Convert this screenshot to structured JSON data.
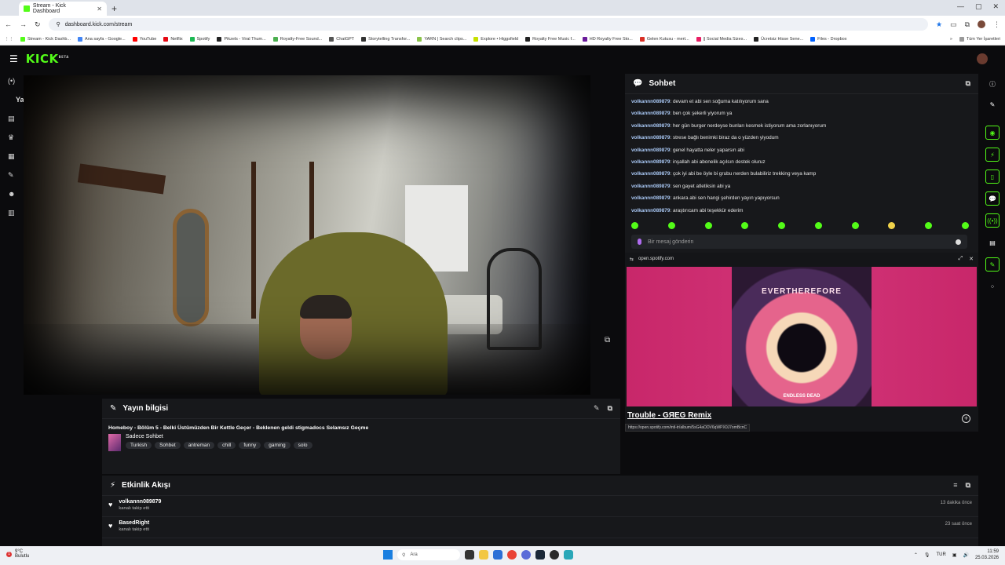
{
  "browser": {
    "tab_title": "Stream - Kick Dashboard",
    "new_tab": "+",
    "url": "dashboard.kick.com/stream",
    "bookmarks": [
      {
        "label": "Stream - Kick Dashb...",
        "color": "#53fc18"
      },
      {
        "label": "Ana sayfa - Google...",
        "color": "#4285f4"
      },
      {
        "label": "YouTube",
        "color": "#ff0000"
      },
      {
        "label": "Netflix",
        "color": "#e50914"
      },
      {
        "label": "Spotify",
        "color": "#1db954"
      },
      {
        "label": "Pikzels - Viral Thum...",
        "color": "#222222"
      },
      {
        "label": "Royalty-Free Sound...",
        "color": "#4caf50"
      },
      {
        "label": "ChatGPT",
        "color": "#555555"
      },
      {
        "label": "Storytelling Transfor...",
        "color": "#333333"
      },
      {
        "label": "YARN | Search clips...",
        "color": "#8bc34a"
      },
      {
        "label": "Explore • Higgsfield",
        "color": "#c6e000"
      },
      {
        "label": "Royalty Free Music f...",
        "color": "#222222"
      },
      {
        "label": "HD Royalty Free Sto...",
        "color": "#6a1b9a"
      },
      {
        "label": "Gelen Kutusu - mert...",
        "color": "#d93025"
      },
      {
        "label": "|| Social Media Sizes...",
        "color": "#e91e63"
      },
      {
        "label": "Ücretsiz Hisse Sene...",
        "color": "#222222"
      },
      {
        "label": "Files - Dropbox",
        "color": "#0061ff"
      }
    ],
    "bookmarks_more": "»",
    "all_bookmarks": "Tüm Yer İşaretleri"
  },
  "kick": {
    "logo": "KICK",
    "logo_badge": "BETA",
    "left_label": "Ya"
  },
  "chat": {
    "title": "Sohbet",
    "messages": [
      {
        "user": "volkannn089879",
        "text": "devam et abi sen soğuma katılıyorum sana"
      },
      {
        "user": "volkannn089879",
        "text": "ben çok şekerli yiyorum ya"
      },
      {
        "user": "volkannn089879",
        "text": "her gün burger nerdeyse bunları kesmek istiyorum ama zorlanıyorum"
      },
      {
        "user": "volkannn089879",
        "text": "strese bağlı benimki biraz da o yüzden yiyodum"
      },
      {
        "user": "volkannn089879",
        "text": "genel hayatta neler yaparsın abi"
      },
      {
        "user": "volkannn089879",
        "text": "inşallah abi abonelik açılsın destek oluruz"
      },
      {
        "user": "volkannn089879",
        "text": "çok iyi abi be öyle bi grubu nerden bulabiliriz trekking veya kamp"
      },
      {
        "user": "volkannn089879",
        "text": "sen gayet atletiksin abi ya"
      },
      {
        "user": "volkannn089879",
        "text": "ankara abi sen hangi şehirden yayın yapıyorsun"
      },
      {
        "user": "volkannn089879",
        "text": "araştırıcam abi teşekkür ederim"
      }
    ],
    "input_placeholder": "Bir mesaj gönderin"
  },
  "spotify": {
    "domain": "open.spotify.com",
    "art_title": "EVERTHEREFORE",
    "art_subtitle": "ENDLESS DEAD",
    "track": "Trouble - GЯEG Remix",
    "link": "https://open.spotify.com/intl-tr/album/5sG4aODV6qWPX0J7omBcnC"
  },
  "stream_info": {
    "heading": "Yayın bilgisi",
    "title": "Homeboy - Bölüm 5 - Belki Üstümüzden Bir Kettle Geçer - Beklenen geldi stigmadocs Selamsız Geçme",
    "category": "Sadece Sohbet",
    "tags": [
      "Turkish",
      "Sohbet",
      "antreman",
      "chill",
      "funny",
      "gaming",
      "solo"
    ]
  },
  "activity": {
    "heading": "Etkinlik Akışı",
    "items": [
      {
        "user": "volkannn089879",
        "action": "kanalı takip etti",
        "time": "13 dakika önce"
      },
      {
        "user": "BasedRight",
        "action": "kanalı takip etti",
        "time": "23 saat önce"
      }
    ]
  },
  "taskbar": {
    "weather_temp": "9°C",
    "weather_desc": "Bulutlu",
    "weather_badge": "1",
    "search_label": "Ara",
    "lang": "TUR",
    "time": "11:59",
    "date": "25.03.2026"
  },
  "colors": {
    "kick_green": "#53fc18",
    "panel_bg": "#17181b",
    "chat_user": "#a9c8f5",
    "spotify_pink": "#d23578"
  }
}
